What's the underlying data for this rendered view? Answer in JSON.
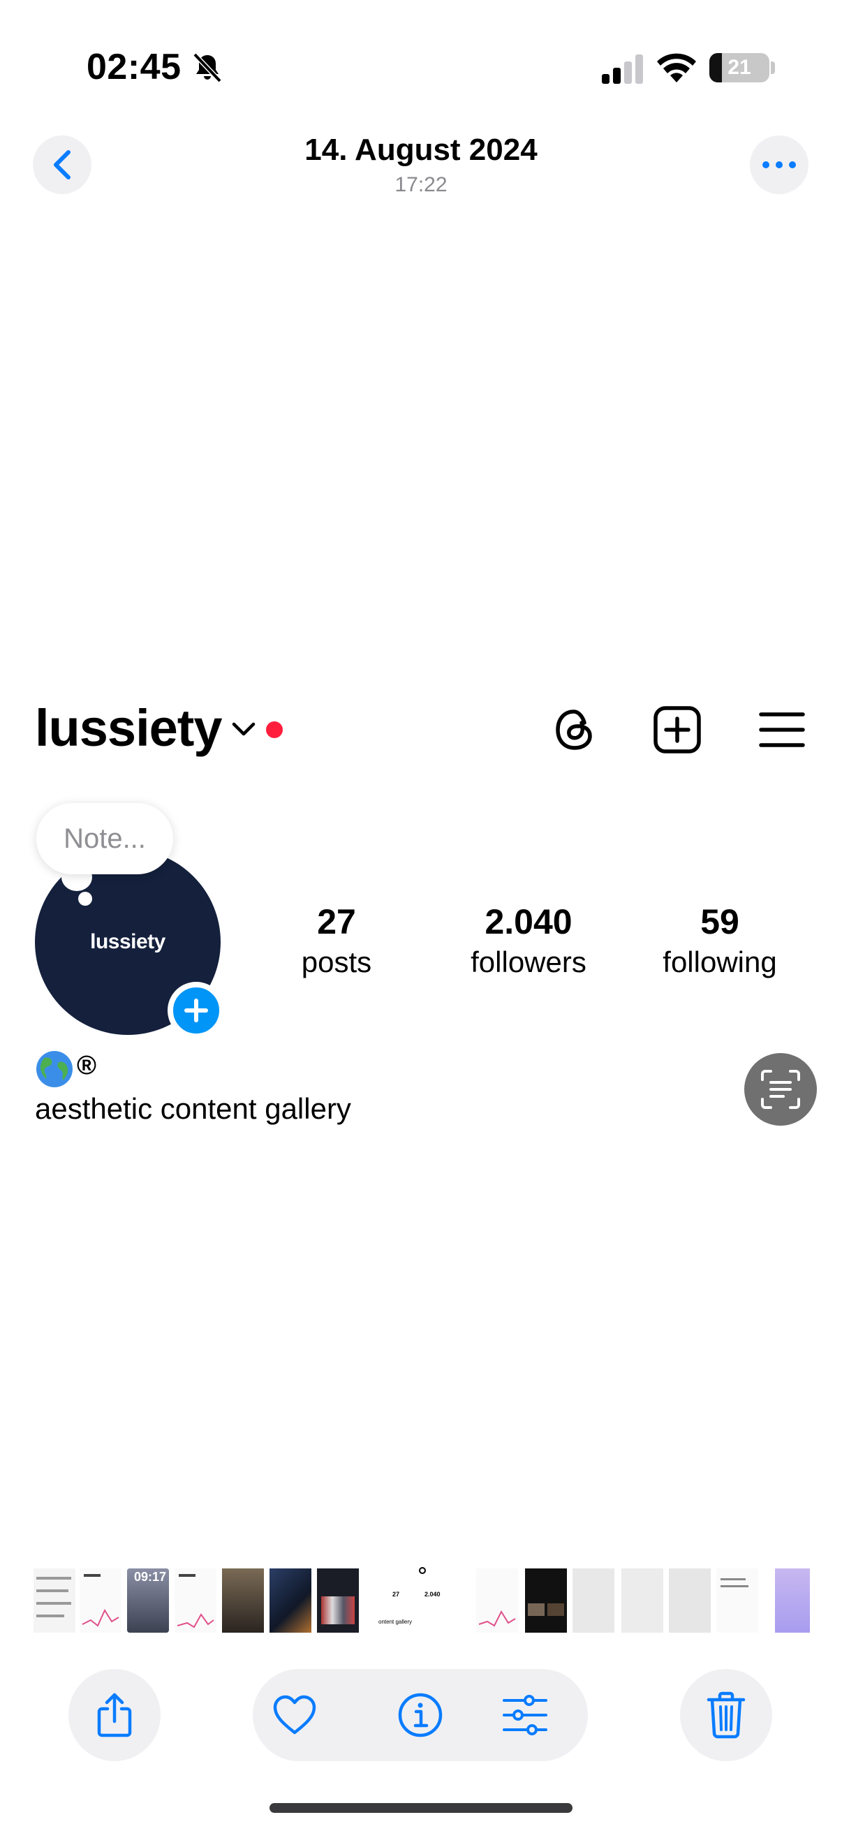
{
  "status_bar": {
    "time": "02:45",
    "battery_level": "21",
    "battery_fraction": 0.21,
    "icons": [
      "bell-slash-icon",
      "cellular-signal-icon",
      "wifi-icon",
      "battery-icon"
    ]
  },
  "photo_nav": {
    "title": "14. August 2024",
    "subtitle": "17:22",
    "accent_color": "#0a7cff"
  },
  "profile": {
    "username": "lussiety",
    "avatar_text": "lussiety",
    "note_placeholder": "Note...",
    "stats": {
      "posts_count": "27",
      "posts_label": "posts",
      "followers_count": "2.040",
      "followers_label": "followers",
      "following_count": "59",
      "following_label": "following"
    },
    "bio_symbol": "®",
    "bio_text": "aesthetic content gallery",
    "notification_dot_color": "#ff1f3d",
    "brand_color": "#0095f6",
    "avatar_color": "#14203c"
  },
  "thumbnail_strip": {
    "selected_stats_posts": "27",
    "selected_stats_followers": "2.040",
    "selected_caption": "ontent gallery"
  },
  "toolbar": {
    "icons": [
      "share-icon",
      "heart-icon",
      "info-icon",
      "adjust-icon",
      "trash-icon"
    ]
  }
}
